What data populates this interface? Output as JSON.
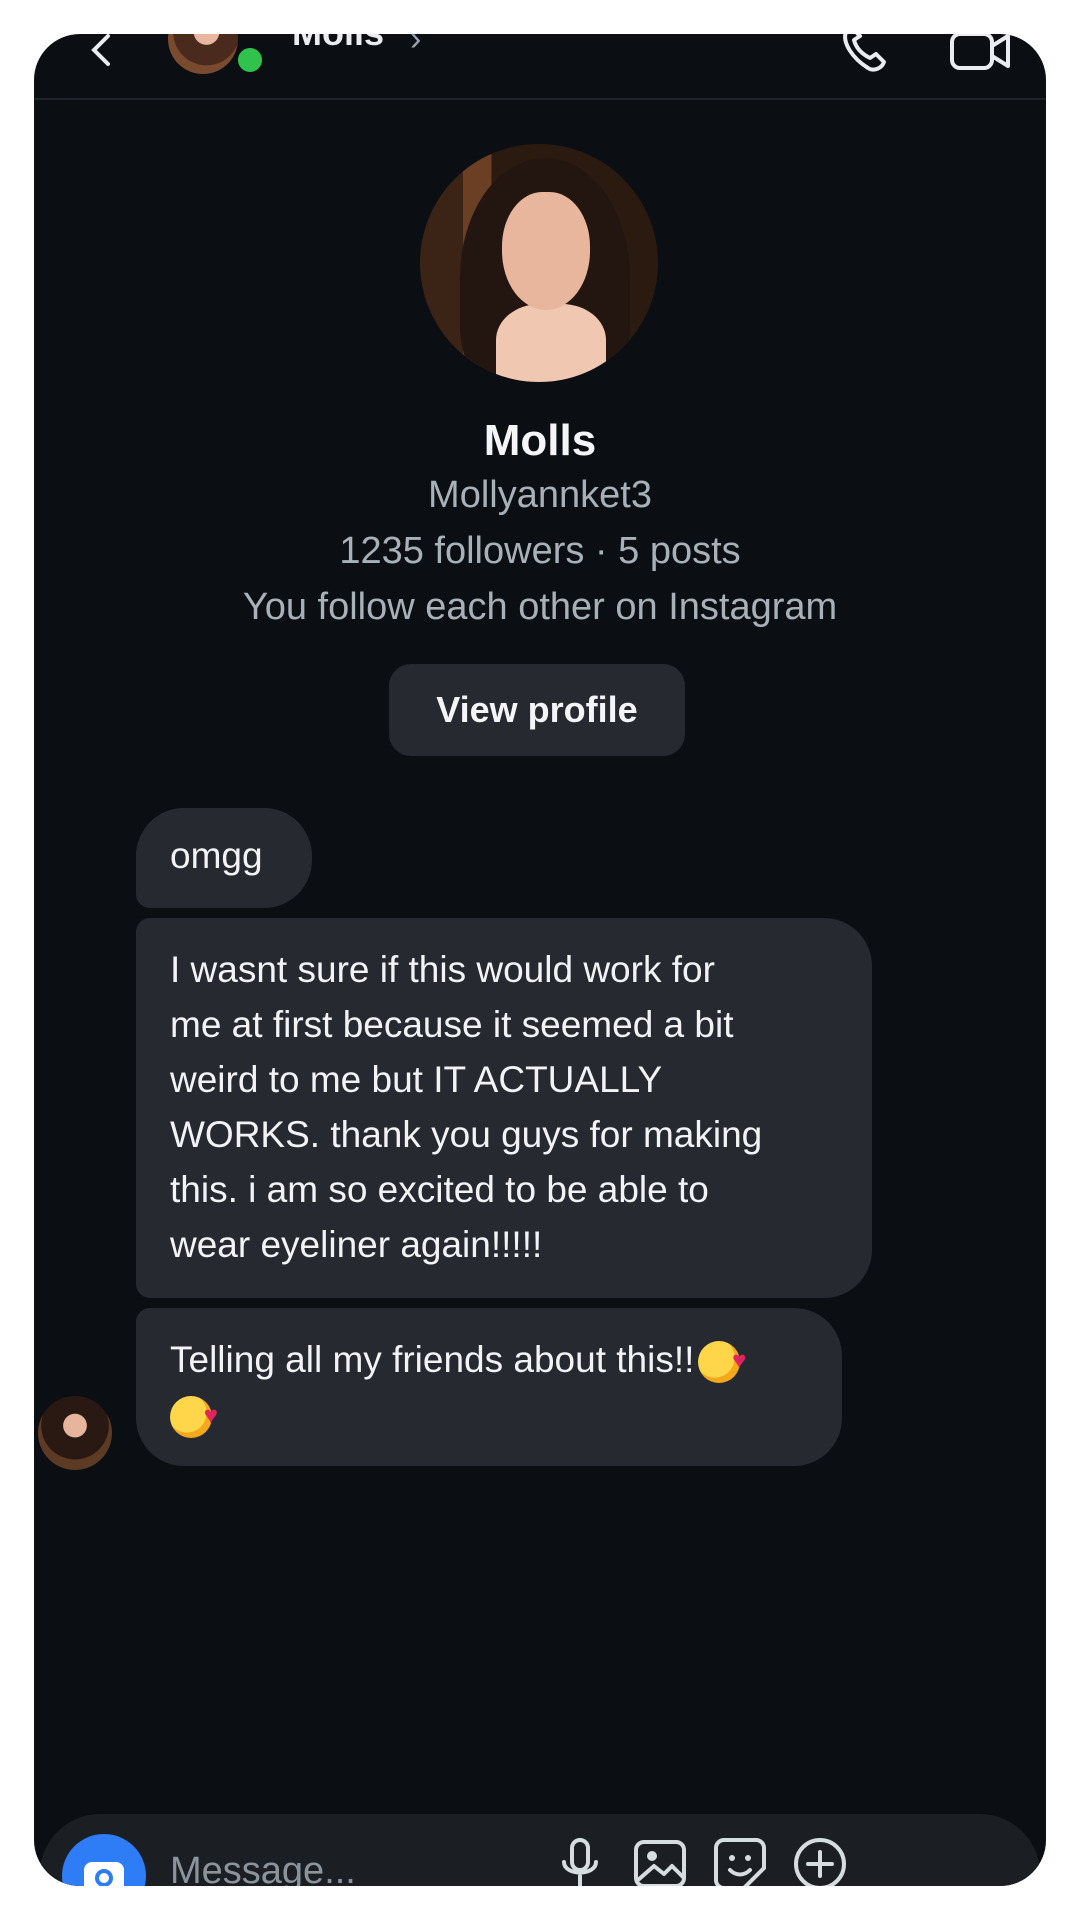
{
  "header": {
    "name": "Molls",
    "chevron": "›",
    "icons": [
      "back-icon",
      "call-icon",
      "video-call-icon"
    ]
  },
  "profile": {
    "name": "Molls",
    "username": "Mollyannket3",
    "stats": "1235 followers · 5 posts",
    "relationship": "You follow each other on Instagram",
    "view_profile_label": "View profile"
  },
  "messages": [
    {
      "text": "omgg"
    },
    {
      "lines": [
        "I wasnt sure if this would work for",
        "me at first because it seemed a bit",
        "weird to me but IT ACTUALLY",
        "WORKS. thank you guys for making",
        "this. i am so excited to be able to",
        "wear eyeliner again!!!!!"
      ]
    },
    {
      "text": "Telling all my friends about this!!"
    }
  ],
  "composer": {
    "placeholder": "Message...",
    "icons": [
      "camera-icon",
      "microphone-icon",
      "gallery-icon",
      "sticker-icon",
      "add-icon"
    ]
  },
  "colors": {
    "background": "#0b0f14",
    "bubble": "#262a30",
    "online": "#31c24d",
    "camera_button": "#2f7df6"
  }
}
